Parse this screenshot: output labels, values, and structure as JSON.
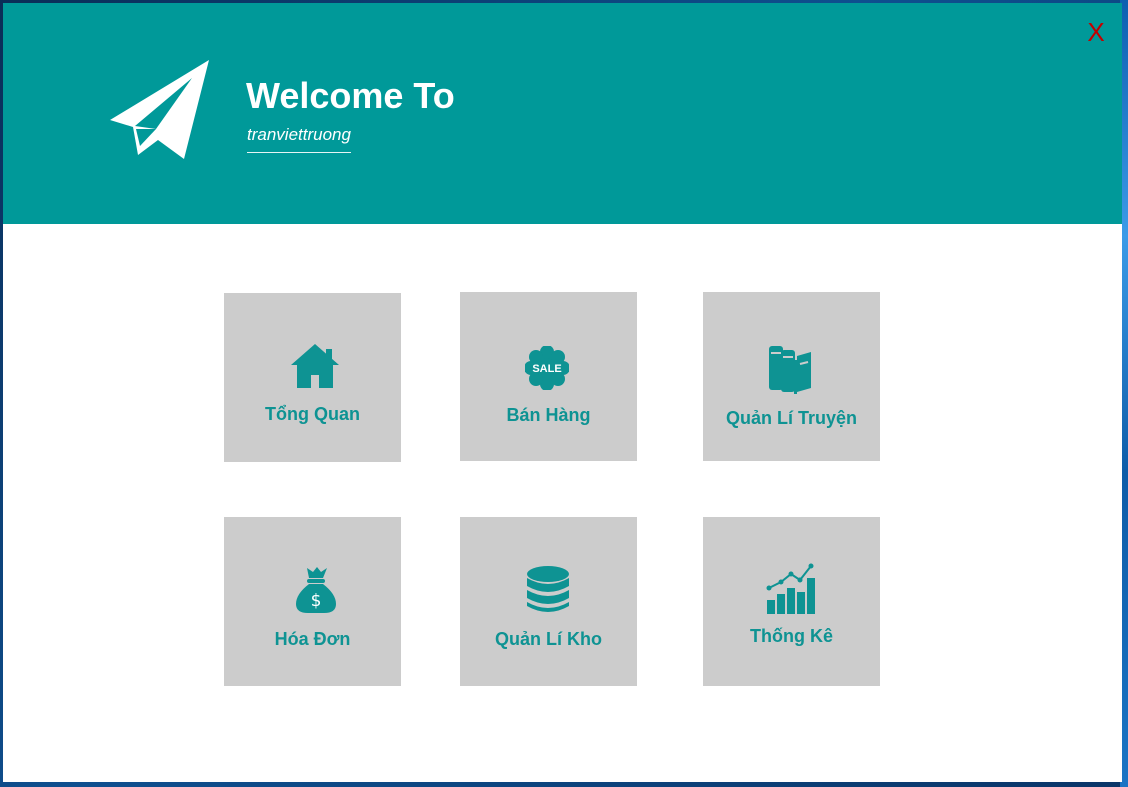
{
  "header": {
    "title": "Welcome To",
    "username": "tranviettruong",
    "close_label": "X",
    "background_color": "#009999",
    "logo_icon": "paper-plane-icon"
  },
  "menu": {
    "tiles": [
      {
        "label": "Tổng Quan",
        "icon": "home-icon"
      },
      {
        "label": "Bán Hàng",
        "icon": "sale-badge-icon",
        "icon_text": "SALE"
      },
      {
        "label": "Quản Lí Truyện",
        "icon": "books-icon"
      },
      {
        "label": "Hóa Đơn",
        "icon": "money-bag-icon",
        "icon_text": "$"
      },
      {
        "label": "Quản Lí Kho",
        "icon": "database-icon"
      },
      {
        "label": "Thống Kê",
        "icon": "statistics-chart-icon"
      }
    ],
    "tile_color": "#cccccc",
    "accent_color": "#0e9393"
  }
}
